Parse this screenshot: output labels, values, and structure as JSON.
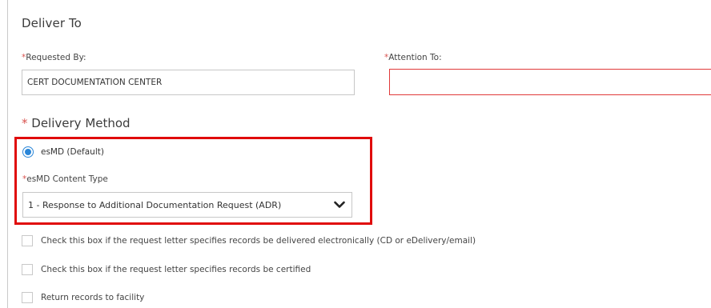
{
  "deliver_to": {
    "title": "Deliver To",
    "requested_by": {
      "required_marker": "*",
      "label": "Requested By:",
      "value": "CERT DOCUMENTATION CENTER"
    },
    "attention_to": {
      "required_marker": "*",
      "label": "Attention To:",
      "value": "",
      "state": "error",
      "error_border_color": "#e03a3a"
    }
  },
  "delivery_method": {
    "required_marker": "*",
    "title": "Delivery Method",
    "highlight_color": "#e00c0c",
    "radio": {
      "label": "esMD (Default)",
      "selected": true,
      "color": "#2a86d8"
    },
    "content_type": {
      "required_marker": "*",
      "label": "esMD Content Type",
      "selected_value": "1 - Response to Additional Documentation Request (ADR)",
      "chevron_icon": "chevron-down-icon"
    }
  },
  "checkboxes": [
    {
      "label": "Check this box if the request letter specifies records be delivered electronically (CD or eDelivery/email)",
      "checked": false
    },
    {
      "label": "Check this box if the request letter specifies records be certified",
      "checked": false
    },
    {
      "label": "Return records to facility",
      "checked": false
    }
  ]
}
